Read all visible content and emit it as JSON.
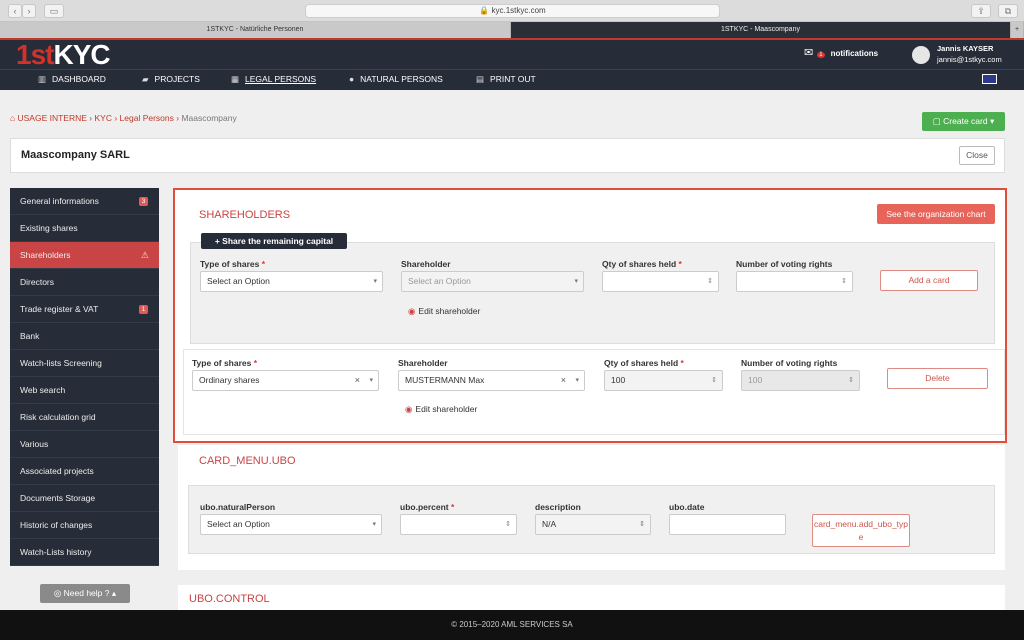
{
  "browser": {
    "url": "kyc.1stkyc.com",
    "tabs": [
      "1STKYC - Natürliche Personen",
      "1STKYC - Maascompany"
    ],
    "new_tab": "+"
  },
  "header": {
    "logo_one": "1st",
    "logo_kyc": "KYC",
    "notifications_label": "notifications",
    "notifications_count": "1",
    "user_name": "Jannis KAYSER",
    "user_email": "jannis@1stkyc.com",
    "nav": [
      {
        "label": "DASHBOARD",
        "icon": "chart-icon"
      },
      {
        "label": "PROJECTS",
        "icon": "folder-icon"
      },
      {
        "label": "LEGAL PERSONS",
        "icon": "building-icon"
      },
      {
        "label": "NATURAL PERSONS",
        "icon": "person-icon"
      },
      {
        "label": "PRINT OUT",
        "icon": "print-icon"
      }
    ]
  },
  "breadcrumb": [
    "USAGE INTERNE",
    "KYC",
    "Legal Persons",
    "Maascompany"
  ],
  "create_card": "Create card",
  "page_title": "Maascompany SARL",
  "close_label": "Close",
  "sidebar": {
    "items": [
      {
        "label": "General informations",
        "badge": "3"
      },
      {
        "label": "Existing shares"
      },
      {
        "label": "Shareholders",
        "warning": "⚠"
      },
      {
        "label": "Directors"
      },
      {
        "label": "Trade register & VAT",
        "badge": "1"
      },
      {
        "label": "Bank"
      },
      {
        "label": "Watch-lists Screening"
      },
      {
        "label": "Web search"
      },
      {
        "label": "Risk calculation grid"
      },
      {
        "label": "Various"
      },
      {
        "label": "Associated projects"
      },
      {
        "label": "Documents Storage"
      },
      {
        "label": "Historic of changes"
      },
      {
        "label": "Watch-Lists history"
      }
    ],
    "need_help": "Need help ?"
  },
  "shareholders": {
    "title": "SHAREHOLDERS",
    "org_chart": "See the organization chart",
    "share_remaining": "Share the remaining capital",
    "new_row": {
      "type_label": "Type of shares",
      "type_value": "Select an Option",
      "holder_label": "Shareholder",
      "holder_value": "Select an Option",
      "qty_label": "Qty of shares held",
      "qty_value": "",
      "voting_label": "Number of voting rights",
      "voting_value": "",
      "add_button": "Add a card",
      "edit_label": "Edit shareholder"
    },
    "row1": {
      "type_label": "Type of shares",
      "type_value": "Ordinary shares",
      "holder_label": "Shareholder",
      "holder_value": "MUSTERMANN Max",
      "qty_label": "Qty of shares held",
      "qty_value": "100",
      "voting_label": "Number of voting rights",
      "voting_value": "100",
      "delete_button": "Delete",
      "edit_label": "Edit shareholder"
    },
    "required_mark": "*"
  },
  "ubo": {
    "title": "CARD_MENU.UBO",
    "person_label": "ubo.naturalPerson",
    "person_value": "Select an Option",
    "percent_label": "ubo.percent",
    "percent_value": "",
    "desc_label": "description",
    "desc_value": "N/A",
    "date_label": "ubo.date",
    "date_value": "",
    "add_button": "card_menu.add_ubo_type"
  },
  "ubo_control": {
    "title": "UBO.CONTROL"
  },
  "footer": "© 2015–2020 AML SERVICES SA"
}
